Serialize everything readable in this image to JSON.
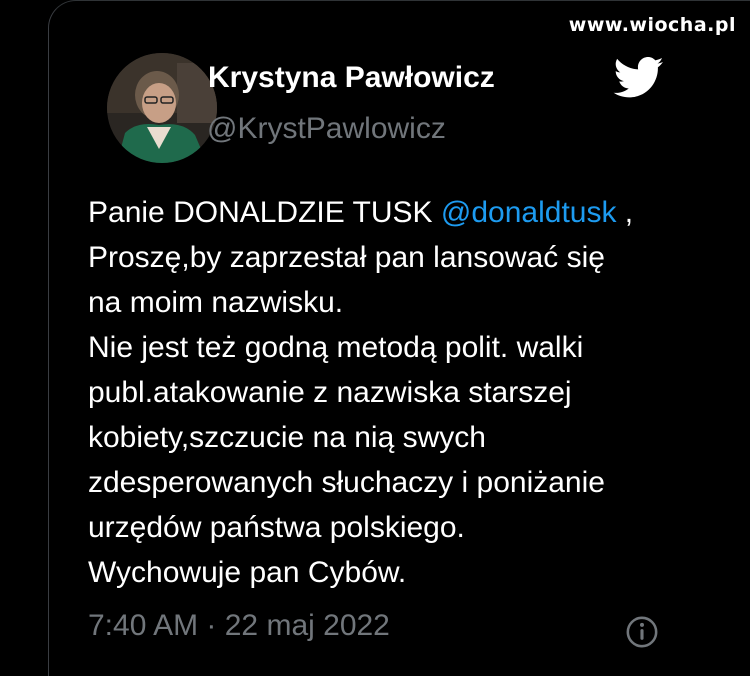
{
  "watermark": "www.wiocha.pl",
  "author": {
    "name": "Krystyna Pawłowicz",
    "handle": "@KrystPawlowicz"
  },
  "tweet": {
    "line1_prefix": "Panie DONALDZIE TUSK ",
    "mention": "@donaldtusk",
    "line1_suffix": " ,",
    "lines": [
      "Proszę,by zaprzestał pan lansować się",
      "na moim nazwisku.",
      "Nie jest też godną metodą polit. walki",
      "publ.atakowanie z nazwiska starszej",
      "kobiety,szczucie na nią swych",
      "zdesperowanych słuchaczy i poniżanie",
      "urzędów państwa polskiego.",
      "Wychowuje pan Cybów."
    ]
  },
  "meta": {
    "time": "7:40 AM",
    "separator": " · ",
    "date": "22 maj 2022"
  },
  "icons": {
    "brand": "twitter-bird-icon",
    "info": "info-icon"
  },
  "colors": {
    "background": "#000000",
    "text": "#ffffff",
    "secondary": "#71767b",
    "mention": "#1d9bf0"
  }
}
